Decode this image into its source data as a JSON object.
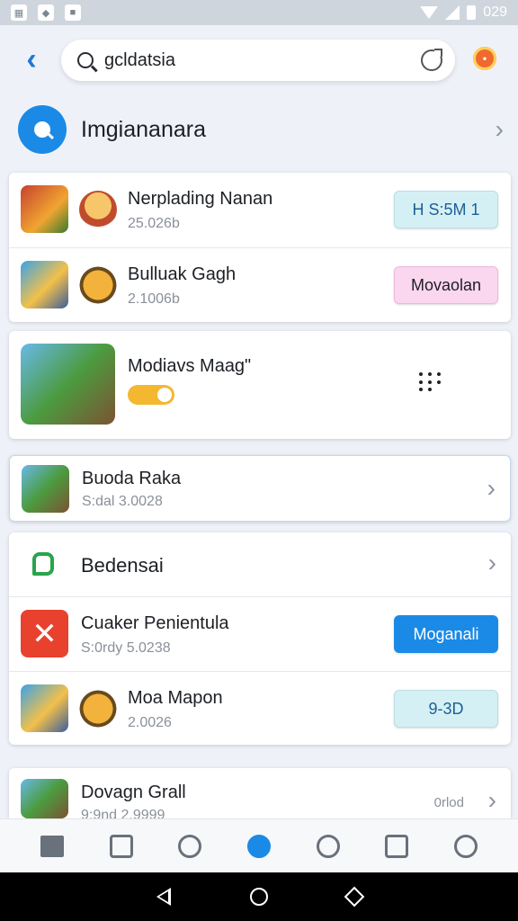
{
  "status_bar": {
    "time": "029"
  },
  "search": {
    "value": "gcldatsia"
  },
  "section_header": {
    "title": "Imgiananara"
  },
  "card1": {
    "rows": [
      {
        "title": "Nerplading Nanan",
        "subtitle": "25.026b",
        "action": "H S:5M 1"
      },
      {
        "title": "Bulluak Gagh",
        "subtitle": "2.1006b",
        "action": "Movaolan"
      }
    ]
  },
  "card2": {
    "title": "Modiavs Maag\""
  },
  "card3": {
    "title": "Buoda Raka",
    "subtitle": "S:dal  3.0028"
  },
  "card4": {
    "title": "Bedensai",
    "rows": [
      {
        "title": "Cuaker Penientula",
        "subtitle": "S:0rdy  5.0238",
        "action": "Moganali"
      },
      {
        "title": "Moa Mapon",
        "subtitle": "2.0026",
        "action": "9-3D"
      }
    ]
  },
  "card5": {
    "title": "Dovagn Grall",
    "subtitle": "9:9nd  2.9999",
    "meta": "0rlod"
  },
  "colors": {
    "accent": "#1b8ae6",
    "pill_teal": "#d5f0f4",
    "pill_pink": "#fbd6ef",
    "pill_blue": "#1b8ae6"
  }
}
